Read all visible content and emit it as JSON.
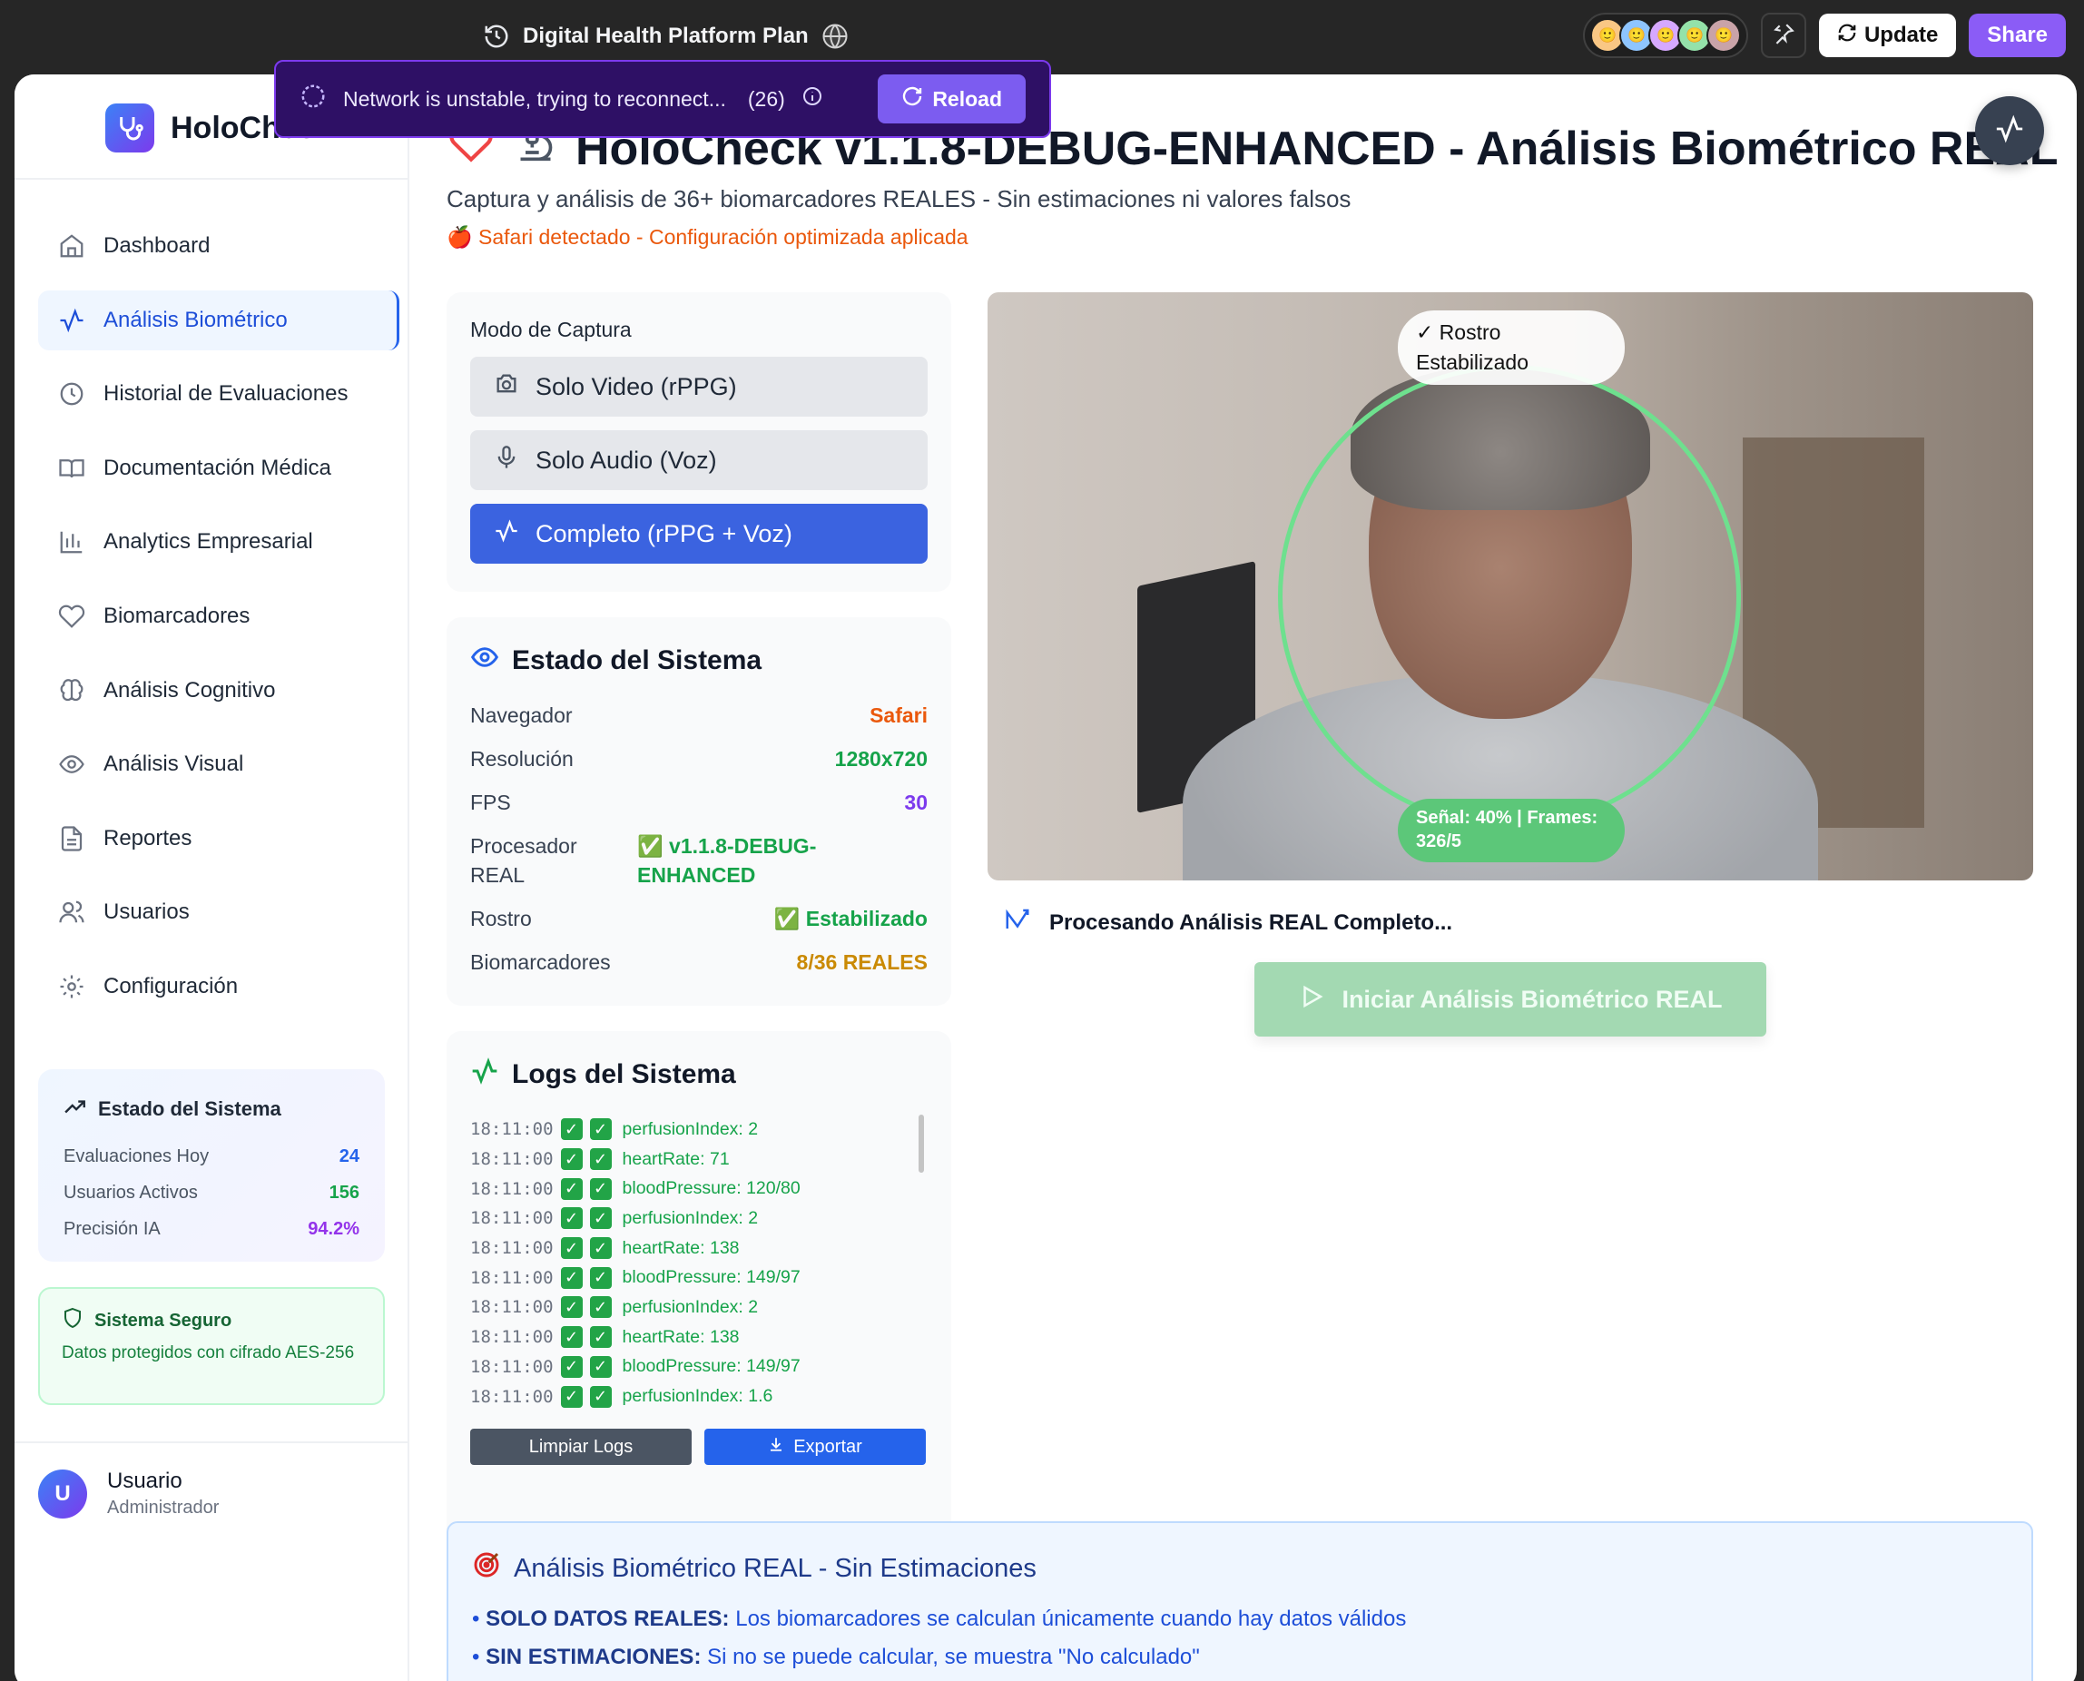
{
  "topbar": {
    "title": "Digital Health Platform Plan",
    "update_label": "Update",
    "share_label": "Share"
  },
  "toast": {
    "message": "Network is unstable, trying to reconnect...",
    "count": "(26)",
    "reload_label": "Reload"
  },
  "sidebar": {
    "brand": "HoloCheck",
    "items": [
      {
        "label": "Dashboard",
        "icon": "home-icon"
      },
      {
        "label": "Análisis Biométrico",
        "icon": "activity-icon"
      },
      {
        "label": "Historial de Evaluaciones",
        "icon": "clock-icon"
      },
      {
        "label": "Documentación Médica",
        "icon": "book-icon"
      },
      {
        "label": "Analytics Empresarial",
        "icon": "bar-chart-icon"
      },
      {
        "label": "Biomarcadores",
        "icon": "heart-icon"
      },
      {
        "label": "Análisis Cognitivo",
        "icon": "brain-icon"
      },
      {
        "label": "Análisis Visual",
        "icon": "eye-icon"
      },
      {
        "label": "Reportes",
        "icon": "file-icon"
      },
      {
        "label": "Usuarios",
        "icon": "users-icon"
      },
      {
        "label": "Configuración",
        "icon": "gear-icon"
      }
    ],
    "status": {
      "title": "Estado del Sistema",
      "rows": [
        {
          "label": "Evaluaciones Hoy",
          "value": "24"
        },
        {
          "label": "Usuarios Activos",
          "value": "156"
        },
        {
          "label": "Precisión IA",
          "value": "94.2%"
        }
      ]
    },
    "secure": {
      "title": "Sistema Seguro",
      "text": "Datos protegidos con cifrado AES-256"
    },
    "user": {
      "initial": "U",
      "name": "Usuario",
      "role": "Administrador"
    }
  },
  "main": {
    "title": "HoloCheck v1.1.8-DEBUG-ENHANCED - Análisis Biométrico REAL",
    "subtitle": "Captura y análisis de 36+ biomarcadores REALES - Sin estimaciones ni valores falsos",
    "safari_note": "🍎 Safari detectado - Configuración optimizada aplicada"
  },
  "capture": {
    "label": "Modo de Captura",
    "modes": [
      {
        "label": "Solo Video (rPPG)",
        "icon": "camera-icon"
      },
      {
        "label": "Solo Audio (Voz)",
        "icon": "mic-icon"
      },
      {
        "label": "Completo (rPPG + Voz)",
        "icon": "activity-icon"
      }
    ]
  },
  "state": {
    "title": "Estado del Sistema",
    "rows": [
      {
        "label": "Navegador",
        "value": "Safari",
        "color": "#ea580c"
      },
      {
        "label": "Resolución",
        "value": "1280x720",
        "color": "#16a34a"
      },
      {
        "label": "FPS",
        "value": "30",
        "color": "#7c3aed"
      },
      {
        "label": "Procesador REAL",
        "value": "✅ v1.1.8-DEBUG-ENHANCED",
        "color": "#16a34a"
      },
      {
        "label": "Rostro",
        "value": "✅ Estabilizado",
        "color": "#16a34a"
      },
      {
        "label": "Biomarcadores",
        "value": "8/36 REALES",
        "color": "#ca8a04"
      }
    ]
  },
  "logs": {
    "title": "Logs del Sistema",
    "entries": [
      {
        "time": "18:11:00",
        "msg": "perfusionIndex: 2"
      },
      {
        "time": "18:11:00",
        "msg": "heartRate: 71"
      },
      {
        "time": "18:11:00",
        "msg": "bloodPressure: 120/80"
      },
      {
        "time": "18:11:00",
        "msg": "perfusionIndex: 2"
      },
      {
        "time": "18:11:00",
        "msg": "heartRate: 138"
      },
      {
        "time": "18:11:00",
        "msg": "bloodPressure: 149/97"
      },
      {
        "time": "18:11:00",
        "msg": "perfusionIndex: 2"
      },
      {
        "time": "18:11:00",
        "msg": "heartRate: 138"
      },
      {
        "time": "18:11:00",
        "msg": "bloodPressure: 149/97"
      },
      {
        "time": "18:11:00",
        "msg": "perfusionIndex: 1.6"
      }
    ],
    "clear_label": "Limpiar Logs",
    "export_label": "Exportar"
  },
  "video": {
    "face_badge": "✓ Rostro Estabilizado",
    "signal_badge": "Señal: 40% | Frames: 326/5"
  },
  "processing_text": "Procesando Análisis REAL Completo...",
  "start_button": "Iniciar Análisis Biométrico REAL",
  "info": {
    "title": "Análisis Biométrico REAL - Sin Estimaciones",
    "lines": [
      {
        "bold": "SOLO DATOS REALES:",
        "text": " Los biomarcadores se calculan únicamente cuando hay datos válidos"
      },
      {
        "bold": "SIN ESTIMACIONES:",
        "text": " Si no se puede calcular, se muestra \"No calculado\""
      }
    ]
  }
}
